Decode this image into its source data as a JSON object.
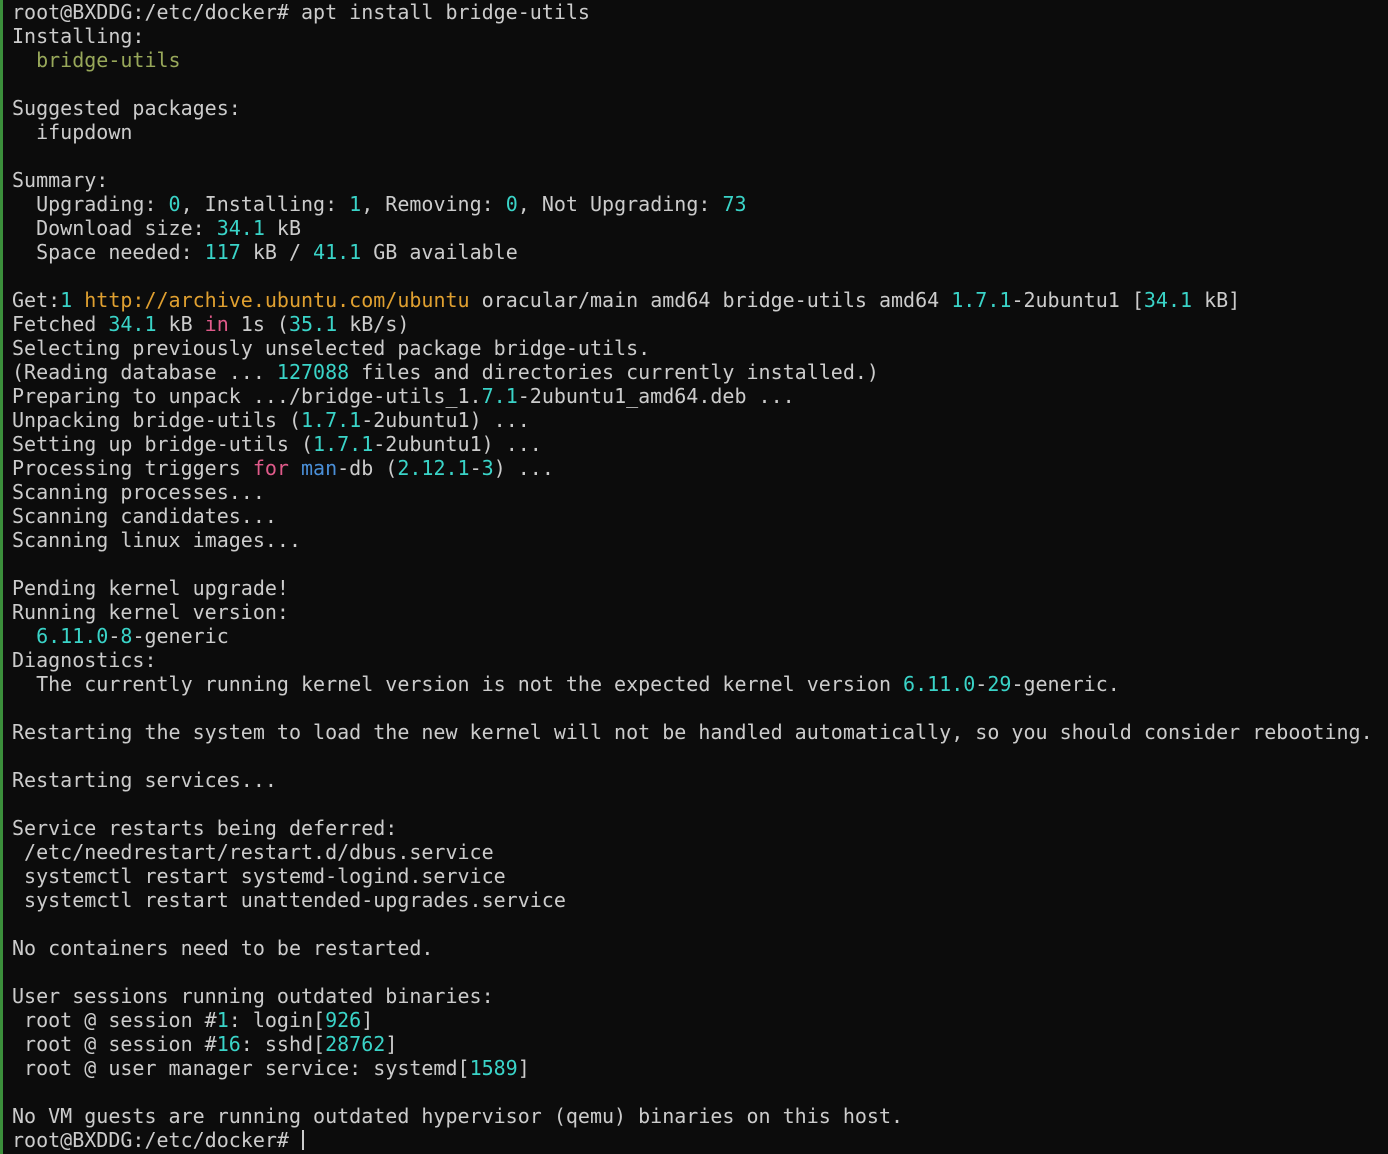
{
  "colors": {
    "background": "#0c0c0c",
    "text": "#cccccc",
    "number": "#3ad4c8",
    "url": "#e0a030",
    "package": "#98a85a",
    "keyword": "#e05a8a",
    "command": "#4a8fd8",
    "left_edge": "#3b8f3b"
  },
  "lines": [
    [
      {
        "t": "root@BXDDG:/etc/docker# apt install bridge-utils"
      }
    ],
    [
      {
        "t": "Installing:"
      }
    ],
    [
      {
        "t": "  "
      },
      {
        "t": "bridge-utils",
        "c": "package"
      }
    ],
    [],
    [
      {
        "t": "Suggested packages:"
      }
    ],
    [
      {
        "t": "  ifupdown"
      }
    ],
    [],
    [
      {
        "t": "Summary:"
      }
    ],
    [
      {
        "t": "  Upgrading: "
      },
      {
        "t": "0",
        "c": "number"
      },
      {
        "t": ", Installing: "
      },
      {
        "t": "1",
        "c": "number"
      },
      {
        "t": ", Removing: "
      },
      {
        "t": "0",
        "c": "number"
      },
      {
        "t": ", Not Upgrading: "
      },
      {
        "t": "73",
        "c": "number"
      }
    ],
    [
      {
        "t": "  Download size: "
      },
      {
        "t": "34.1",
        "c": "number"
      },
      {
        "t": " kB"
      }
    ],
    [
      {
        "t": "  Space needed: "
      },
      {
        "t": "117",
        "c": "number"
      },
      {
        "t": " kB / "
      },
      {
        "t": "41.1",
        "c": "number"
      },
      {
        "t": " GB available"
      }
    ],
    [],
    [
      {
        "t": "Get:"
      },
      {
        "t": "1",
        "c": "number"
      },
      {
        "t": " "
      },
      {
        "t": "http://archive.ubuntu.com/ubuntu",
        "c": "url"
      },
      {
        "t": " oracular/main amd64 bridge-utils amd64 "
      },
      {
        "t": "1.7.1",
        "c": "number"
      },
      {
        "t": "-2ubuntu1 ["
      },
      {
        "t": "34.1",
        "c": "number"
      },
      {
        "t": " kB]"
      }
    ],
    [
      {
        "t": "Fetched "
      },
      {
        "t": "34.1",
        "c": "number"
      },
      {
        "t": " kB "
      },
      {
        "t": "in",
        "c": "keyword"
      },
      {
        "t": " 1s ("
      },
      {
        "t": "35.1",
        "c": "number"
      },
      {
        "t": " kB/s)"
      }
    ],
    [
      {
        "t": "Selecting previously unselected package bridge-utils."
      }
    ],
    [
      {
        "t": "(Reading database ... "
      },
      {
        "t": "127088",
        "c": "number"
      },
      {
        "t": " files and directories currently installed.)"
      }
    ],
    [
      {
        "t": "Preparing to unpack .../bridge-utils_1."
      },
      {
        "t": "7.1",
        "c": "number"
      },
      {
        "t": "-2ubuntu1_amd64.deb ..."
      }
    ],
    [
      {
        "t": "Unpacking bridge-utils ("
      },
      {
        "t": "1.7.1",
        "c": "number"
      },
      {
        "t": "-2ubuntu1) ..."
      }
    ],
    [
      {
        "t": "Setting up bridge-utils ("
      },
      {
        "t": "1.7.1",
        "c": "number"
      },
      {
        "t": "-2ubuntu1) ..."
      }
    ],
    [
      {
        "t": "Processing triggers "
      },
      {
        "t": "for",
        "c": "keyword"
      },
      {
        "t": " "
      },
      {
        "t": "man",
        "c": "command"
      },
      {
        "t": "-db ("
      },
      {
        "t": "2.12.1",
        "c": "number"
      },
      {
        "t": "-"
      },
      {
        "t": "3",
        "c": "number"
      },
      {
        "t": ") ..."
      }
    ],
    [
      {
        "t": "Scanning processes..."
      }
    ],
    [
      {
        "t": "Scanning candidates..."
      }
    ],
    [
      {
        "t": "Scanning linux images..."
      }
    ],
    [],
    [
      {
        "t": "Pending kernel upgrade!"
      }
    ],
    [
      {
        "t": "Running kernel version:"
      }
    ],
    [
      {
        "t": "  "
      },
      {
        "t": "6.11.0",
        "c": "number"
      },
      {
        "t": "-"
      },
      {
        "t": "8",
        "c": "number"
      },
      {
        "t": "-generic"
      }
    ],
    [
      {
        "t": "Diagnostics:"
      }
    ],
    [
      {
        "t": "  The currently running kernel version is not the expected kernel version "
      },
      {
        "t": "6.11.0",
        "c": "number"
      },
      {
        "t": "-"
      },
      {
        "t": "29",
        "c": "number"
      },
      {
        "t": "-generic."
      }
    ],
    [],
    [
      {
        "t": "Restarting the system to load the new kernel will not be handled automatically, so you should consider rebooting."
      }
    ],
    [],
    [
      {
        "t": "Restarting services..."
      }
    ],
    [],
    [
      {
        "t": "Service restarts being deferred:"
      }
    ],
    [
      {
        "t": " /etc/needrestart/restart.d/dbus.service"
      }
    ],
    [
      {
        "t": " systemctl restart systemd-logind.service"
      }
    ],
    [
      {
        "t": " systemctl restart unattended-upgrades.service"
      }
    ],
    [],
    [
      {
        "t": "No containers need to be restarted."
      }
    ],
    [],
    [
      {
        "t": "User sessions running outdated binaries:"
      }
    ],
    [
      {
        "t": " root @ session #"
      },
      {
        "t": "1",
        "c": "number"
      },
      {
        "t": ": login["
      },
      {
        "t": "926",
        "c": "number"
      },
      {
        "t": "]"
      }
    ],
    [
      {
        "t": " root @ session #"
      },
      {
        "t": "16",
        "c": "number"
      },
      {
        "t": ": sshd["
      },
      {
        "t": "28762",
        "c": "number"
      },
      {
        "t": "]"
      }
    ],
    [
      {
        "t": " root @ user manager service: systemd["
      },
      {
        "t": "1589",
        "c": "number"
      },
      {
        "t": "]"
      }
    ],
    [],
    [
      {
        "t": "No VM guests are running outdated hypervisor (qemu) binaries on this host."
      }
    ],
    [
      {
        "t": "root@BXDDG:/etc/docker# "
      }
    ]
  ]
}
